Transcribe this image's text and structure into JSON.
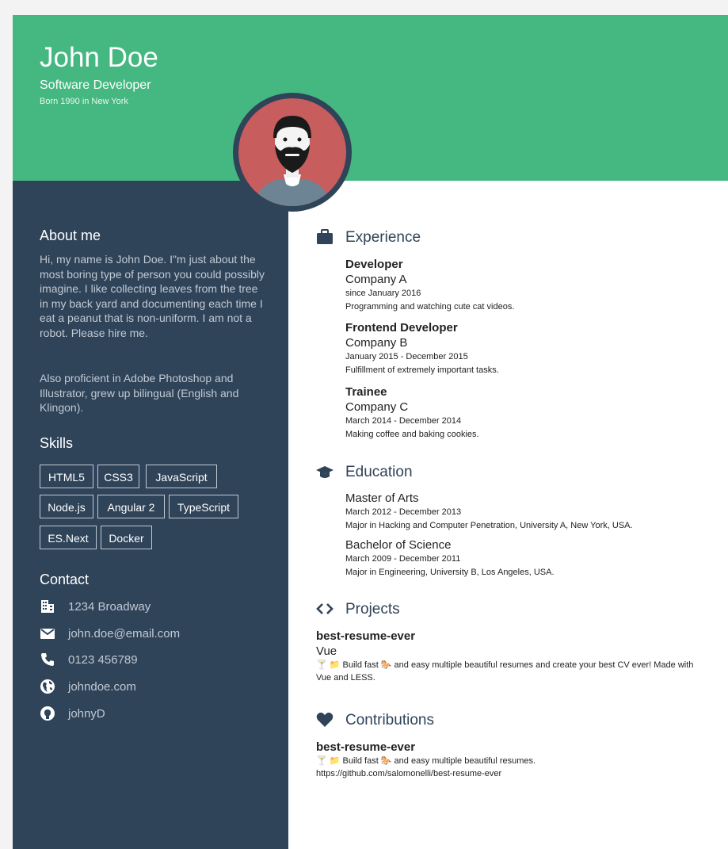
{
  "header": {
    "name": "John Doe",
    "title": "Software Developer",
    "born": "Born 1990 in New York"
  },
  "about": {
    "heading": "About me",
    "text": "Hi, my name is John Doe. I\"m just about the most boring type of person you could possibly imagine. I like collecting leaves from the tree in my back yard and documenting each time I eat a peanut that is non-uniform. I am not a robot. Please hire me.",
    "text2": "Also proficient in Adobe Photoshop and Illustrator, grew up bilingual (English and Klingon)."
  },
  "skills": {
    "heading": "Skills",
    "items": [
      "HTML5",
      "CSS3",
      "JavaScript",
      "Node.js",
      "Angular 2",
      "TypeScript",
      "ES.Next",
      "Docker"
    ]
  },
  "contact": {
    "heading": "Contact",
    "address": "1234 Broadway",
    "email": "john.doe@email.com",
    "phone": "0123 456789",
    "website": "johndoe.com",
    "github": "johnyD"
  },
  "experience": {
    "heading": "Experience",
    "items": [
      {
        "position": "Developer",
        "company": "Company A",
        "dates": "since January 2016",
        "description": "Programming and watching cute cat videos."
      },
      {
        "position": "Frontend Developer",
        "company": "Company B",
        "dates": "January 2015 - December 2015",
        "description": "Fulfillment of extremely important tasks."
      },
      {
        "position": "Trainee",
        "company": "Company C",
        "dates": "March 2014 - December 2014",
        "description": "Making coffee and baking cookies."
      }
    ]
  },
  "education": {
    "heading": "Education",
    "items": [
      {
        "degree": "Master of Arts",
        "dates": "March 2012 - December 2013",
        "description": "Major in Hacking and Computer Penetration, University A, New York, USA."
      },
      {
        "degree": "Bachelor of Science",
        "dates": "March 2009 - December 2011",
        "description": "Major in Engineering, University B, Los Angeles, USA."
      }
    ]
  },
  "projects": {
    "heading": "Projects",
    "items": [
      {
        "name": "best-resume-ever",
        "platform": "Vue",
        "description": "🍸 📁 Build fast 🐎 and easy multiple beautiful resumes and create your best CV ever! Made with Vue and LESS."
      }
    ]
  },
  "contributions": {
    "heading": "Contributions",
    "items": [
      {
        "name": "best-resume-ever",
        "description": "🍸 📁 Build fast 🐎 and easy multiple beautiful resumes.",
        "url": "https://github.com/salomonelli/best-resume-ever"
      }
    ]
  },
  "colors": {
    "header_green": "#45b881",
    "sidebar_navy": "#2f4359",
    "avatar_red": "#c75d5d",
    "sidebar_text": "#c2cad3"
  }
}
